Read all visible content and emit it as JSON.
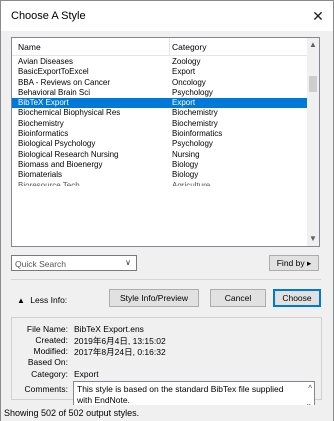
{
  "window": {
    "title": "Choose A Style",
    "close_glyph": "✕"
  },
  "list": {
    "columns": [
      "Name",
      "Category"
    ],
    "rows": [
      {
        "name": "Avian Diseases",
        "category": "Zoology"
      },
      {
        "name": "BasicExportToExcel",
        "category": "Export"
      },
      {
        "name": "BBA - Reviews on Cancer",
        "category": "Oncology"
      },
      {
        "name": "Behavioral Brain Sci",
        "category": "Psychology"
      },
      {
        "name": "BibTeX Export",
        "category": "Export",
        "selected": true
      },
      {
        "name": "Biochemical Biophysical Res",
        "category": "Biochemistry"
      },
      {
        "name": "Biochemistry",
        "category": "Biochemistry"
      },
      {
        "name": "Bioinformatics",
        "category": "Bioinformatics"
      },
      {
        "name": "Biological Psychology",
        "category": "Psychology"
      },
      {
        "name": "Biological Research Nursing",
        "category": "Nursing"
      },
      {
        "name": "Biomass and Bioenergy",
        "category": "Biology"
      },
      {
        "name": "Biomaterials",
        "category": "Biology"
      }
    ],
    "partial_row": {
      "name": "Bioresource Tech",
      "category": "Agriculture"
    },
    "scroll_up": "▲",
    "scroll_down": "▼"
  },
  "search": {
    "placeholder": "Quick Search",
    "dropdown_glyph": "∨",
    "findby_label": "Find by ▸"
  },
  "buttons": {
    "less_info": "Less Info:",
    "less_info_glyph": "▲",
    "style_info": "Style Info/Preview",
    "cancel": "Cancel",
    "choose": "Choose"
  },
  "info": {
    "file_name_label": "File Name:",
    "file_name": "BibTeX Export.ens",
    "created_label": "Created:",
    "created": "2019年6月4日, 13:15:02",
    "modified_label": "Modified:",
    "modified": "2017年8月24日, 0:16:32",
    "based_on_label": "Based On:",
    "based_on": "",
    "category_label": "Category:",
    "category": "Export",
    "comments_label": "Comments:",
    "comments": "This style is based on the standard BibTex file supplied with EndNote."
  },
  "status": {
    "text": "Showing 502 of 502 output styles."
  }
}
